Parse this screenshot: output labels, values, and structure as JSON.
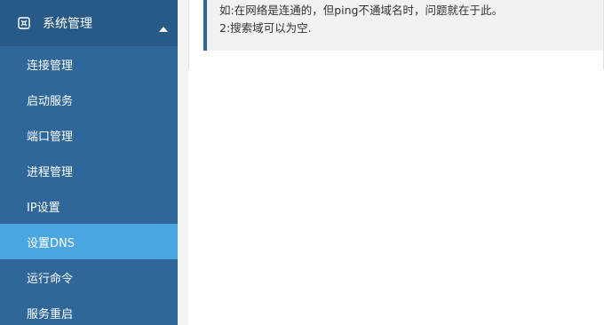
{
  "sidebar": {
    "section": {
      "title": "系统管理",
      "icon": "system-settings-icon",
      "caret_icon": "caret-up-icon"
    },
    "items": [
      {
        "label": "连接管理",
        "active": false
      },
      {
        "label": "启动服务",
        "active": false
      },
      {
        "label": "端口管理",
        "active": false
      },
      {
        "label": "进程管理",
        "active": false
      },
      {
        "label": "IP设置",
        "active": false
      },
      {
        "label": "设置DNS",
        "active": true
      },
      {
        "label": "运行命令",
        "active": false
      },
      {
        "label": "服务重启",
        "active": false
      }
    ],
    "colors": {
      "background": "#2f679a",
      "header": "#285a87",
      "active": "#4aa6e0"
    }
  },
  "main": {
    "notes": [
      "如:在网络是连通的，但ping不通域名时，问题就在于此。",
      "2:搜索域可以为空."
    ]
  }
}
